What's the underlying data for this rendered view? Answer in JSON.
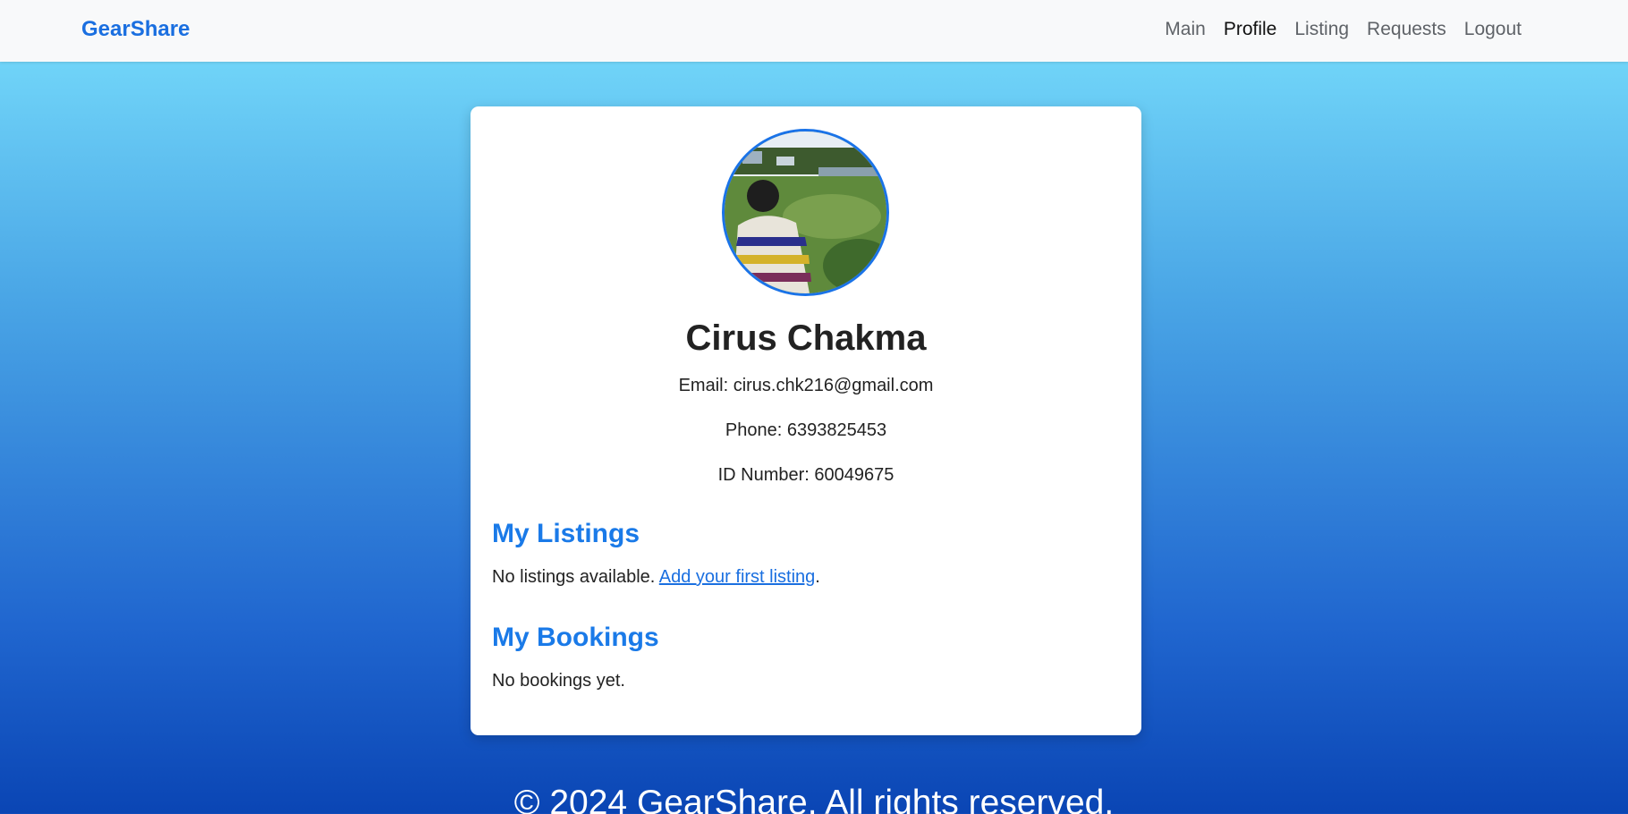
{
  "nav": {
    "brand": "GearShare",
    "items": [
      {
        "label": "Main"
      },
      {
        "label": "Profile"
      },
      {
        "label": "Listing"
      },
      {
        "label": "Requests"
      },
      {
        "label": "Logout"
      }
    ],
    "active": "Profile"
  },
  "profile": {
    "avatar_icon": "user-photo",
    "name": "Cirus Chakma",
    "email": "Email: cirus.chk216@gmail.com",
    "phone": "Phone: 6393825453",
    "id_number": "ID Number: 60049675"
  },
  "listings": {
    "title": "My Listings",
    "empty_text": "No listings available. ",
    "link_text": "Add your first listing",
    "trailing": "."
  },
  "bookings": {
    "title": "My Bookings",
    "empty_text": "No bookings yet."
  },
  "footer": {
    "text": "© 2024 GearShare. All rights reserved."
  },
  "colors": {
    "brand": "#1a6fe0",
    "section_title": "#1a7ae8",
    "avatar_border": "#1a73e8"
  }
}
